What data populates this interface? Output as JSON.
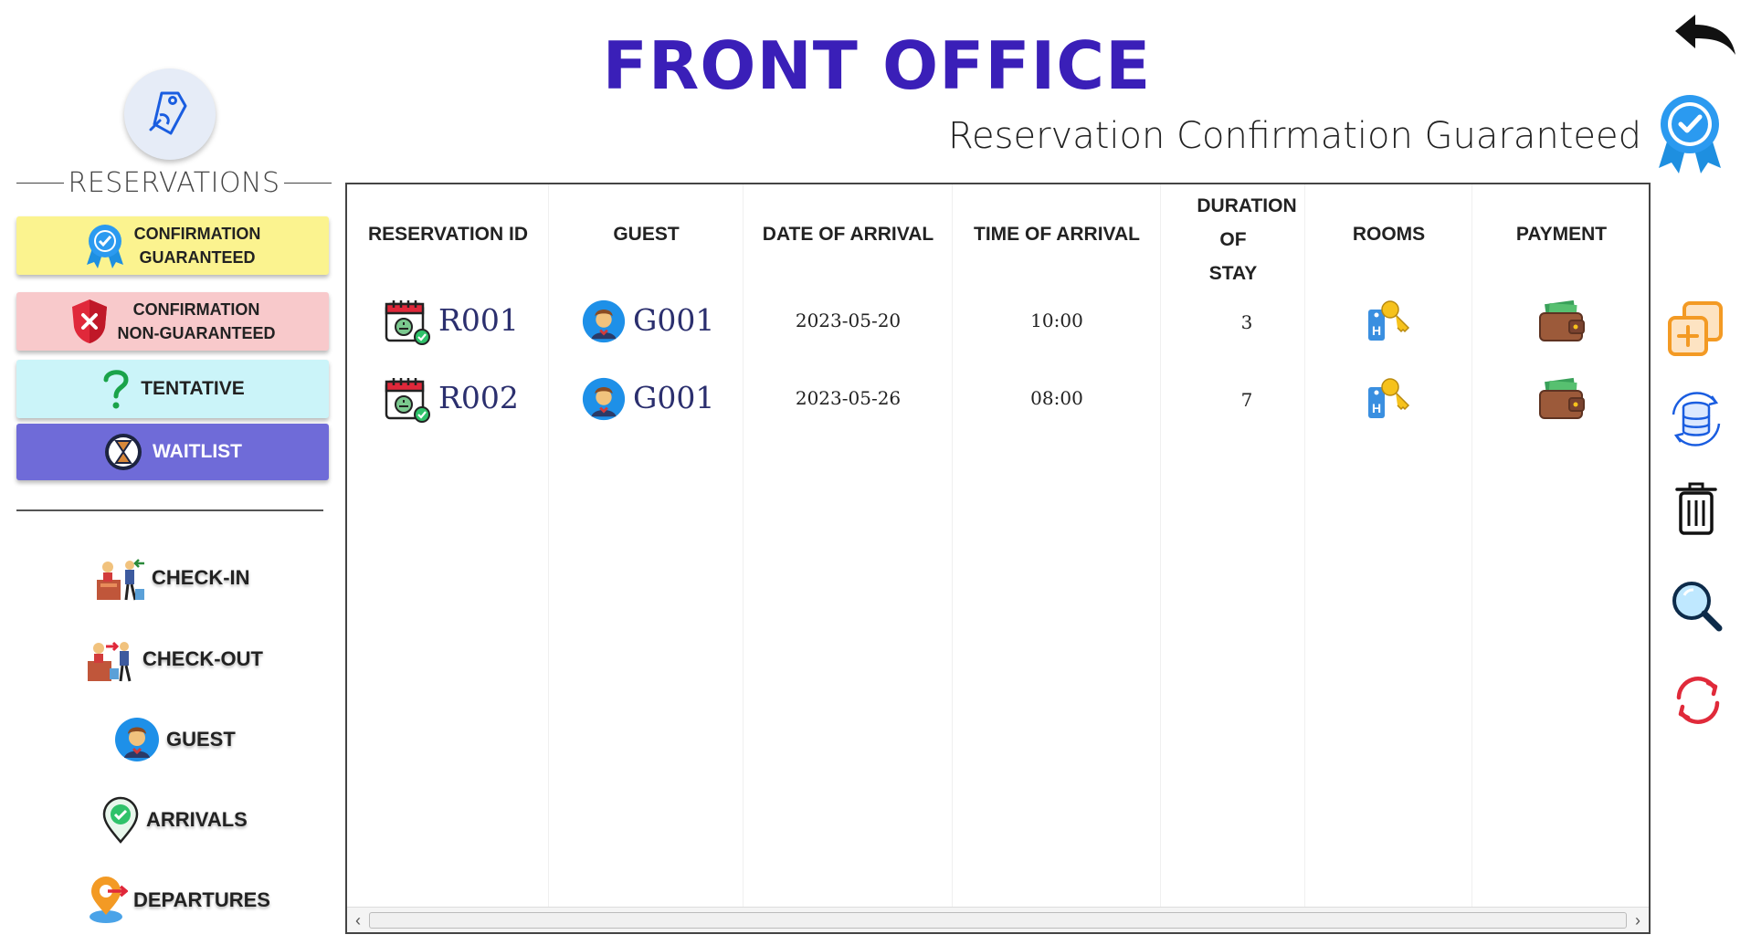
{
  "header": {
    "title": "FRONT OFFICE",
    "subtitle": "Reservation Confirmation Guaranteed",
    "back_icon": "undo-arrow-icon",
    "badge_icon": "verified-ribbon-icon"
  },
  "sidebar": {
    "logo_icon": "tag-hand-icon",
    "section_label": "RESERVATIONS",
    "status_buttons": [
      {
        "line1": "CONFIRMATION",
        "line2": "GUARANTEED",
        "icon": "verified-ribbon-icon",
        "color": "#fbf38f"
      },
      {
        "line1": "CONFIRMATION",
        "line2": "NON-GUARANTEED",
        "icon": "shield-x-icon",
        "color": "#f8c9cb"
      },
      {
        "label": "TENTATIVE",
        "icon": "question-mark-icon",
        "color": "#cbf4f9"
      },
      {
        "label": "WAITLIST",
        "icon": "hourglass-icon",
        "color": "#6f6bd8"
      }
    ],
    "nav": [
      {
        "label": "CHECK-IN",
        "icon": "check-in-icon"
      },
      {
        "label": "CHECK-OUT",
        "icon": "check-out-icon"
      },
      {
        "label": "GUEST",
        "icon": "guest-avatar-icon"
      },
      {
        "label": "ARRIVALS",
        "icon": "location-check-icon"
      },
      {
        "label": "DEPARTURES",
        "icon": "departure-pin-icon"
      }
    ]
  },
  "table": {
    "headers": {
      "reservation_id": "RESERVATION ID",
      "guest": "GUEST",
      "date_of_arrival": "DATE OF ARRIVAL",
      "time_of_arrival": "TIME OF ARRIVAL",
      "duration_line1": "DURATION",
      "duration_line2": "OF",
      "duration_line3": "STAY",
      "rooms": "ROOMS",
      "payment": "PAYMENT"
    },
    "rows": [
      {
        "reservation_id": "R001",
        "guest": "G001",
        "date_of_arrival": "2023-05-20",
        "time_of_arrival": "10:00",
        "duration": "3"
      },
      {
        "reservation_id": "R002",
        "guest": "G001",
        "date_of_arrival": "2023-05-26",
        "time_of_arrival": "08:00",
        "duration": "7"
      }
    ]
  },
  "toolbar": {
    "tools": [
      "add-copy-icon",
      "database-sync-icon",
      "trash-icon",
      "search-icon",
      "refresh-icon"
    ]
  },
  "colors": {
    "title": "#3a1fb8",
    "guaranteed": "#fbf38f",
    "non_guaranteed": "#f8c9cb",
    "tentative": "#cbf4f9",
    "waitlist": "#6f6bd8"
  }
}
